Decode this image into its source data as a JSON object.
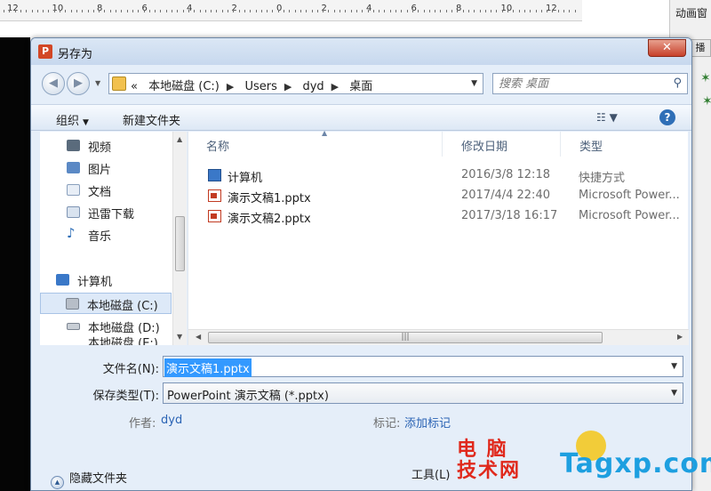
{
  "ruler": {
    "numbers": [
      "12",
      "10",
      "8",
      "6",
      "4",
      "2",
      "0",
      "2",
      "4",
      "6",
      "8",
      "10",
      "12"
    ]
  },
  "right_pane": {
    "title": "动画窗",
    "button_label": "播"
  },
  "dialog": {
    "title": "另存为",
    "app_icon_letter": "P",
    "close_label": "✕"
  },
  "address_bar": {
    "prefix": "«",
    "crumbs": [
      "本地磁盘 (C:)",
      "Users",
      "dyd",
      "桌面"
    ]
  },
  "search": {
    "placeholder": "搜索 桌面"
  },
  "toolbar": {
    "organize_label": "组织",
    "new_folder_label": "新建文件夹"
  },
  "nav_pane": {
    "items": [
      {
        "label": "视频",
        "icon": "video-icon"
      },
      {
        "label": "图片",
        "icon": "pictures-icon"
      },
      {
        "label": "文档",
        "icon": "documents-icon"
      },
      {
        "label": "迅雷下载",
        "icon": "download-icon"
      },
      {
        "label": "音乐",
        "icon": "music-icon"
      },
      {
        "label": "计算机",
        "icon": "computer-icon"
      },
      {
        "label": "本地磁盘 (C:)",
        "icon": "drive-icon",
        "selected": true
      },
      {
        "label": "本地磁盘 (D:)",
        "icon": "drive-icon"
      },
      {
        "label": "本地磁盘 (E:)",
        "icon": "drive-icon"
      }
    ]
  },
  "file_list": {
    "columns": [
      "名称",
      "修改日期",
      "类型"
    ],
    "rows": [
      {
        "name": "计算机",
        "date": "2016/3/8 12:18",
        "type": "快捷方式",
        "icon": "computer-shortcut-icon"
      },
      {
        "name": "演示文稿1.pptx",
        "date": "2017/4/4 22:40",
        "type": "Microsoft Power...",
        "icon": "pptx-file-icon"
      },
      {
        "name": "演示文稿2.pptx",
        "date": "2017/3/18 16:17",
        "type": "Microsoft Power...",
        "icon": "pptx-file-icon"
      }
    ]
  },
  "form": {
    "filename_label": "文件名(N):",
    "filename_value": "演示文稿1.pptx",
    "filetype_label": "保存类型(T):",
    "filetype_value": "PowerPoint 演示文稿 (*.pptx)",
    "author_label": "作者:",
    "author_value": "dyd",
    "tags_label": "标记:",
    "tags_value": "添加标记"
  },
  "footer": {
    "hide_folders_label": "隐藏文件夹",
    "tools_label": "工具(L)"
  },
  "watermark": {
    "cn_line1": "电 脑",
    "cn_line2": "技术网",
    "en": "Tagxp.com"
  },
  "colors": {
    "accent": "#3399ff",
    "link": "#2a63b4",
    "close": "#c7402a"
  }
}
